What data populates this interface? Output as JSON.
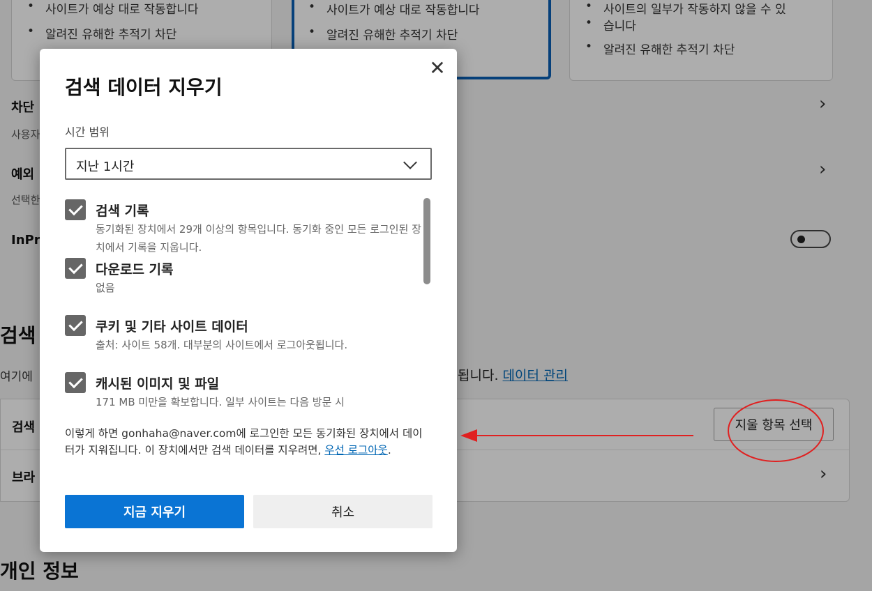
{
  "colors": {
    "primary": "#0a74d4",
    "link": "#0066b4",
    "annotation": "#e02020"
  },
  "background": {
    "cards": [
      {
        "bullets": [
          "사이트가 예상 대로 작동합니다",
          "알려진 유해한 추적기 차단"
        ]
      },
      {
        "bullets": [
          "사이트가 예상 대로 작동합니다",
          "알려진 유해한 추적기 차단"
        ]
      },
      {
        "bullets": [
          "사이트의 일부가 작동하지 않을 수 있",
          "습니다",
          "알려진 유해한 추적기 차단"
        ]
      }
    ],
    "rows": [
      {
        "title": "차단",
        "sub": "사용자"
      },
      {
        "title": "예외",
        "sub": "선택한"
      },
      {
        "title": "InPr"
      }
    ],
    "section_title": "검색",
    "section_desc_left": "여기에",
    "section_desc_right": "됩니다.",
    "data_manage_link": "데이터 관리",
    "row4_label": "검색",
    "row5_label": "브라",
    "choose_button": "지울 항목 선택",
    "bottom_section": "개인 정보"
  },
  "dialog": {
    "title": "검색 데이터 지우기",
    "close_icon": "close-icon",
    "time_range_label": "시간 범위",
    "time_range_value": "지난 1시간",
    "items": [
      {
        "label": "검색 기록",
        "desc": "동기화된 장치에서 29개 이상의 항목입니다. 동기화 중인 모든 로그인된 장치에서 기록을 지웁니다.",
        "checked": true
      },
      {
        "label": "다운로드 기록",
        "desc": "없음",
        "checked": true
      },
      {
        "label": "쿠키 및 기타 사이트 데이터",
        "desc": "출처: 사이트 58개. 대부분의 사이트에서 로그아웃됩니다.",
        "checked": true
      },
      {
        "label": "캐시된 이미지 및 파일",
        "desc": "171 MB 미만을 확보합니다. 일부 사이트는 다음 방문 시",
        "checked": true
      }
    ],
    "notice_text": "이렇게 하면 gonhaha@naver.com에 로그인한 모든 동기화된 장치에서 데이터가 지워집니다. 이 장치에서만 검색 데이터를 지우려면, ",
    "notice_link": "우선 로그아웃",
    "notice_end": ".",
    "clear_button": "지금 지우기",
    "cancel_button": "취소"
  }
}
